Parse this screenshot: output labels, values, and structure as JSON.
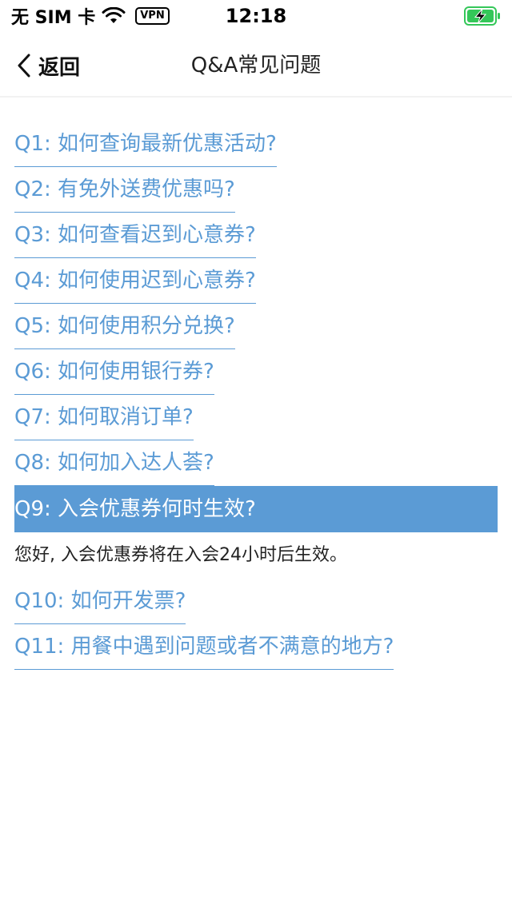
{
  "status_bar": {
    "carrier": "无 SIM 卡",
    "vpn": "VPN",
    "time": "12:18",
    "battery_color": "#34c759"
  },
  "nav": {
    "back_label": "返回",
    "title": "Q&A常见问题"
  },
  "colors": {
    "accent": "#5b9bd5"
  },
  "faq": [
    {
      "question": "Q1: 如何查询最新优惠活动?"
    },
    {
      "question": "Q2: 有免外送费优惠吗?"
    },
    {
      "question": "Q3: 如何查看迟到心意券?"
    },
    {
      "question": "Q4: 如何使用迟到心意券?"
    },
    {
      "question": "Q5: 如何使用积分兑换?"
    },
    {
      "question": "Q6: 如何使用银行券?"
    },
    {
      "question": "Q7: 如何取消订单?"
    },
    {
      "question": "Q8: 如何加入达人荟?"
    },
    {
      "question": "Q9: 入会优惠券何时生效?",
      "answer": "您好, 入会优惠券将在入会24小时后生效。"
    },
    {
      "question": "Q10: 如何开发票?"
    },
    {
      "question": "Q11: 用餐中遇到问题或者不满意的地方?"
    }
  ]
}
